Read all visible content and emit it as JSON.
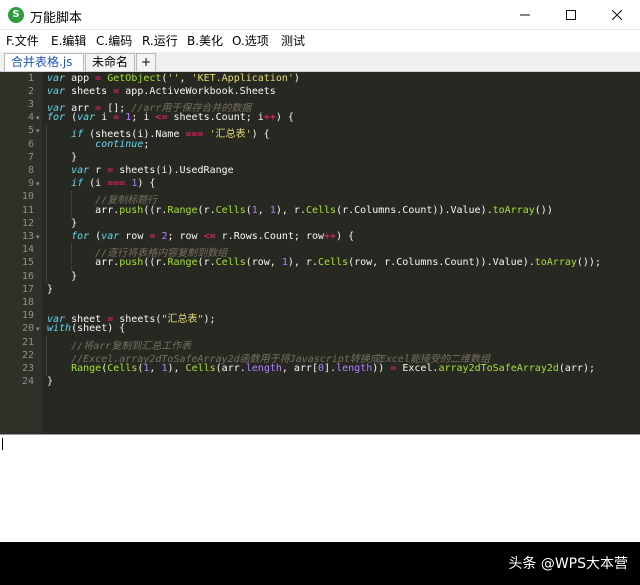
{
  "window": {
    "title": "万能脚本",
    "icon": "script-s-icon"
  },
  "menu": [
    "F.文件",
    "E.编辑",
    "C.编码",
    "R.运行",
    "B.美化",
    "O.选项",
    "测试"
  ],
  "tabs": [
    {
      "label": "合并表格.js",
      "active": true
    },
    {
      "label": "未命名",
      "active": false
    }
  ],
  "tab_add": "+",
  "line_numbers": [
    "1",
    "2",
    "3",
    "4",
    "5",
    "6",
    "7",
    "8",
    "9",
    "10",
    "11",
    "12",
    "13",
    "14",
    "15",
    "16",
    "17",
    "18",
    "19",
    "20",
    "21",
    "22",
    "23",
    "24"
  ],
  "code_lines": [
    [
      [
        "kw",
        "var"
      ],
      [
        "t",
        " app "
      ],
      [
        "op",
        "="
      ],
      [
        "t",
        " "
      ],
      [
        "fn",
        "GetObject"
      ],
      [
        "t",
        "("
      ],
      [
        "str",
        "''"
      ],
      [
        "t",
        ", "
      ],
      [
        "str",
        "'KET.Application'"
      ],
      [
        "t",
        ")"
      ]
    ],
    [
      [
        "kw",
        "var"
      ],
      [
        "t",
        " sheets "
      ],
      [
        "op",
        "="
      ],
      [
        "t",
        " app.ActiveWorkbook.Sheets"
      ]
    ],
    [
      [
        "kw",
        "var"
      ],
      [
        "t",
        " arr "
      ],
      [
        "op",
        "="
      ],
      [
        "t",
        " []; "
      ],
      [
        "cm",
        "//arr用于保存合并的数据"
      ]
    ],
    [
      [
        "kw",
        "for"
      ],
      [
        "t",
        " ("
      ],
      [
        "kw",
        "var"
      ],
      [
        "t",
        " i "
      ],
      [
        "op",
        "="
      ],
      [
        "t",
        " "
      ],
      [
        "num",
        "1"
      ],
      [
        "t",
        "; i "
      ],
      [
        "op",
        "<="
      ],
      [
        "t",
        " sheets.Count; i"
      ],
      [
        "op",
        "++"
      ],
      [
        "t",
        ") {"
      ]
    ],
    [
      [
        "t",
        "    "
      ],
      [
        "kw",
        "if"
      ],
      [
        "t",
        " (sheets(i).Name "
      ],
      [
        "op",
        "==="
      ],
      [
        "t",
        " "
      ],
      [
        "str",
        "'汇总表'"
      ],
      [
        "t",
        ") {"
      ]
    ],
    [
      [
        "t",
        "        "
      ],
      [
        "kw",
        "continue"
      ],
      [
        "t",
        ";"
      ]
    ],
    [
      [
        "t",
        "    }"
      ]
    ],
    [
      [
        "t",
        "    "
      ],
      [
        "kw",
        "var"
      ],
      [
        "t",
        " r "
      ],
      [
        "op",
        "="
      ],
      [
        "t",
        " sheets(i).UsedRange"
      ]
    ],
    [
      [
        "t",
        "    "
      ],
      [
        "kw",
        "if"
      ],
      [
        "t",
        " (i "
      ],
      [
        "op",
        "==="
      ],
      [
        "t",
        " "
      ],
      [
        "num",
        "1"
      ],
      [
        "t",
        ") {"
      ]
    ],
    [
      [
        "t",
        "        "
      ],
      [
        "cm",
        "//复制标题行"
      ]
    ],
    [
      [
        "t",
        "        arr."
      ],
      [
        "fn",
        "push"
      ],
      [
        "t",
        "((r."
      ],
      [
        "fn",
        "Range"
      ],
      [
        "t",
        "(r."
      ],
      [
        "fn",
        "Cells"
      ],
      [
        "t",
        "("
      ],
      [
        "num",
        "1"
      ],
      [
        "t",
        ", "
      ],
      [
        "num",
        "1"
      ],
      [
        "t",
        "), r."
      ],
      [
        "fn",
        "Cells"
      ],
      [
        "t",
        "(r.Columns.Count)).Value)."
      ],
      [
        "fn",
        "toArray"
      ],
      [
        "t",
        "())"
      ]
    ],
    [
      [
        "t",
        "    }"
      ]
    ],
    [
      [
        "t",
        "    "
      ],
      [
        "kw",
        "for"
      ],
      [
        "t",
        " ("
      ],
      [
        "kw",
        "var"
      ],
      [
        "t",
        " row "
      ],
      [
        "op",
        "="
      ],
      [
        "t",
        " "
      ],
      [
        "num",
        "2"
      ],
      [
        "t",
        "; row "
      ],
      [
        "op",
        "<="
      ],
      [
        "t",
        " r.Rows.Count; row"
      ],
      [
        "op",
        "++"
      ],
      [
        "t",
        ") {"
      ]
    ],
    [
      [
        "t",
        "        "
      ],
      [
        "cm",
        "//逐行将表格内容复制到数组"
      ]
    ],
    [
      [
        "t",
        "        arr."
      ],
      [
        "fn",
        "push"
      ],
      [
        "t",
        "((r."
      ],
      [
        "fn",
        "Range"
      ],
      [
        "t",
        "(r."
      ],
      [
        "fn",
        "Cells"
      ],
      [
        "t",
        "(row, "
      ],
      [
        "num",
        "1"
      ],
      [
        "t",
        "), r."
      ],
      [
        "fn",
        "Cells"
      ],
      [
        "t",
        "(row, r.Columns.Count)).Value)."
      ],
      [
        "fn",
        "toArray"
      ],
      [
        "t",
        "());"
      ]
    ],
    [
      [
        "t",
        "    }"
      ]
    ],
    [
      [
        "t",
        "}"
      ]
    ],
    [],
    [
      [
        "kw",
        "var"
      ],
      [
        "t",
        " sheet "
      ],
      [
        "op",
        "="
      ],
      [
        "t",
        " sheets("
      ],
      [
        "str",
        "\"汇总表\""
      ],
      [
        "t",
        ");"
      ]
    ],
    [
      [
        "kw",
        "with"
      ],
      [
        "t",
        "(sheet) {"
      ]
    ],
    [
      [
        "t",
        "    "
      ],
      [
        "cm",
        "//将arr复制到汇总工作表"
      ]
    ],
    [
      [
        "t",
        "    "
      ],
      [
        "cm",
        "//Excel.array2dToSafeArray2d函数用于将Javascript转换成Excel能接受的二维数组"
      ]
    ],
    [
      [
        "t",
        "    "
      ],
      [
        "fn",
        "Range"
      ],
      [
        "t",
        "("
      ],
      [
        "fn",
        "Cells"
      ],
      [
        "t",
        "("
      ],
      [
        "num",
        "1"
      ],
      [
        "t",
        ", "
      ],
      [
        "num",
        "1"
      ],
      [
        "t",
        "), "
      ],
      [
        "fn",
        "Cells"
      ],
      [
        "t",
        "(arr."
      ],
      [
        "num",
        "length"
      ],
      [
        "t",
        ", arr["
      ],
      [
        "num",
        "0"
      ],
      [
        "t",
        "]."
      ],
      [
        "num",
        "length"
      ],
      [
        "t",
        ")) "
      ],
      [
        "op",
        "="
      ],
      [
        "t",
        " Excel."
      ],
      [
        "fn",
        "array2dToSafeArray2d"
      ],
      [
        "t",
        "(arr);"
      ]
    ],
    [
      [
        "t",
        "}"
      ]
    ]
  ],
  "watermark": "头条 @WPS大本营"
}
